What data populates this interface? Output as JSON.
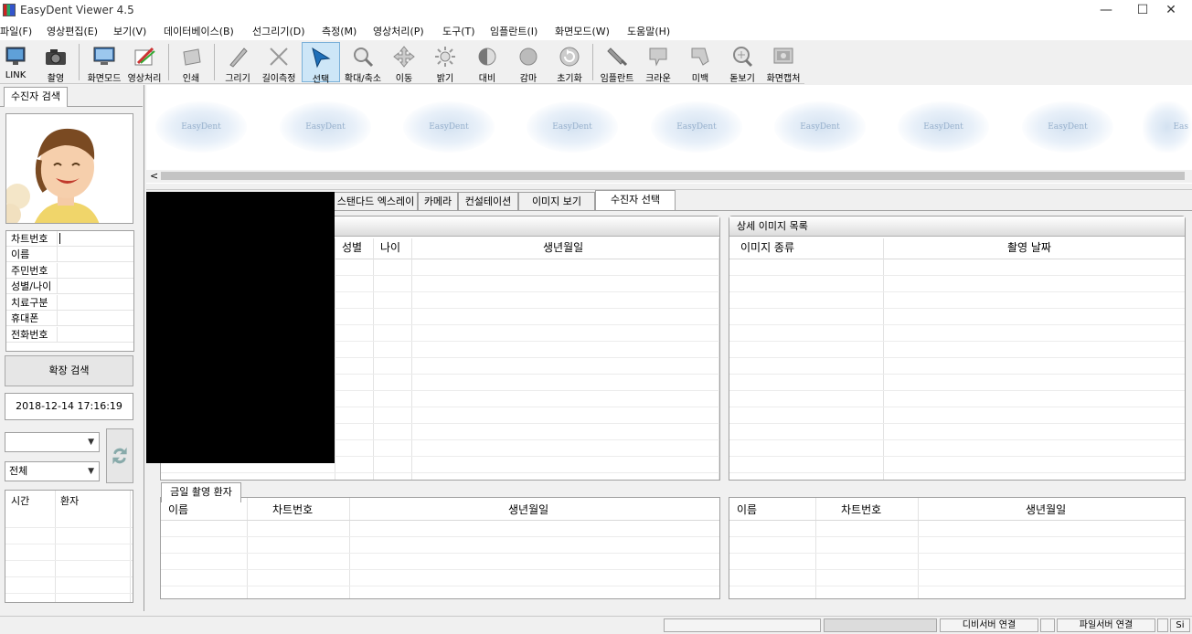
{
  "window": {
    "title": "EasyDent Viewer 4.5",
    "minimize": "—",
    "maximize": "☐",
    "close": "✕"
  },
  "menu": [
    "파일(F)",
    "영상편집(E)",
    "보기(V)",
    "데이터베이스(B)",
    "선그리기(D)",
    "측정(M)",
    "영상처리(P)",
    "도구(T)",
    "임플란트(I)",
    "화면모드(W)",
    "도움말(H)"
  ],
  "toolbar": [
    {
      "label": "LINK",
      "icon": "link-monitor-icon"
    },
    {
      "label": "촬영",
      "icon": "camera-icon"
    },
    {
      "label": "화면모드",
      "icon": "screen-mode-icon"
    },
    {
      "label": "영상처리",
      "icon": "image-process-icon"
    },
    {
      "label": "인쇄",
      "icon": "print-icon"
    },
    {
      "label": "그리기",
      "icon": "pen-icon"
    },
    {
      "label": "길이측정",
      "icon": "measure-icon"
    },
    {
      "label": "선택",
      "icon": "select-arrow-icon"
    },
    {
      "label": "확대/축소",
      "icon": "zoom-icon"
    },
    {
      "label": "이동",
      "icon": "move-icon"
    },
    {
      "label": "밝기",
      "icon": "brightness-icon"
    },
    {
      "label": "대비",
      "icon": "contrast-icon"
    },
    {
      "label": "감마",
      "icon": "gamma-icon"
    },
    {
      "label": "초기화",
      "icon": "reset-icon"
    },
    {
      "label": "임플란트",
      "icon": "implant-icon"
    },
    {
      "label": "크라운",
      "icon": "crown-icon"
    },
    {
      "label": "미백",
      "icon": "whitening-icon"
    },
    {
      "label": "돋보기",
      "icon": "magnifier-icon"
    },
    {
      "label": "화면캡처",
      "icon": "screen-capture-icon"
    }
  ],
  "left": {
    "tab": "수진자 검색",
    "fields": [
      "차트번호",
      "이름",
      "주민번호",
      "성별/나이",
      "치료구분",
      "휴대폰",
      "전화번호"
    ],
    "ext_search": "확장 검색",
    "datetime": "2018-12-14 17:16:19",
    "combo1": "",
    "combo2": "전체",
    "list_headers": [
      "시간",
      "환자"
    ]
  },
  "thumbs": {
    "label": "EasyDent",
    "last_label": "Eas"
  },
  "tabs": [
    "스탠다드 엑스레이",
    "카메라",
    "컨설테이션",
    "이미지 보기",
    "수진자 선택"
  ],
  "patient_grid": {
    "headers": [
      "성별",
      "나이",
      "생년월일"
    ]
  },
  "detail": {
    "title": "상세 이미지 목록",
    "headers": [
      "이미지 종류",
      "촬영 날짜"
    ]
  },
  "today": {
    "tab": "금일 촬영 환자",
    "headers": [
      "이름",
      "차트번호",
      "생년월일"
    ]
  },
  "right_bottom": {
    "headers": [
      "이름",
      "차트번호",
      "생년월일"
    ]
  },
  "status": {
    "db": "디비서버 연결",
    "file": "파일서버 연결",
    "tail": "Si"
  }
}
